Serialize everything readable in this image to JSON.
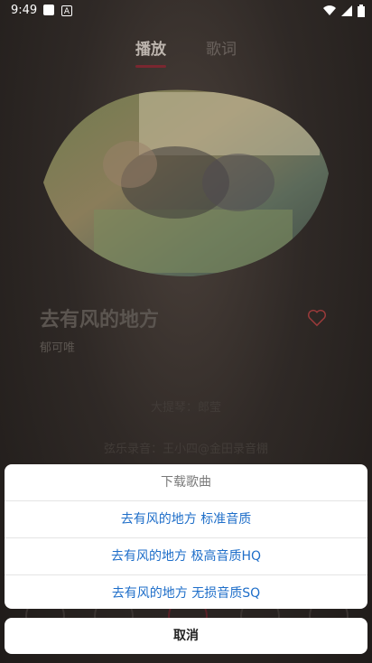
{
  "status_bar": {
    "time": "9:49",
    "notif_icon_letter": "A"
  },
  "tabs": [
    {
      "label": "播放"
    },
    {
      "label": "歌词"
    }
  ],
  "song": {
    "title": "去有风的地方",
    "artist": "郁可唯"
  },
  "lyrics": {
    "line1": "大提琴：郎莹",
    "line2": "弦乐录音：王小四@金田录音棚"
  },
  "download_sheet": {
    "title": "下载歌曲",
    "options": [
      {
        "label": "去有风的地方 标准音质"
      },
      {
        "label": "去有风的地方 极高音质HQ"
      },
      {
        "label": "去有风的地方 无损音质SQ"
      }
    ],
    "cancel_label": "取消"
  },
  "colors": {
    "accent": "#7a2730",
    "link": "#1e6ec9",
    "heart": "#c0392b"
  }
}
